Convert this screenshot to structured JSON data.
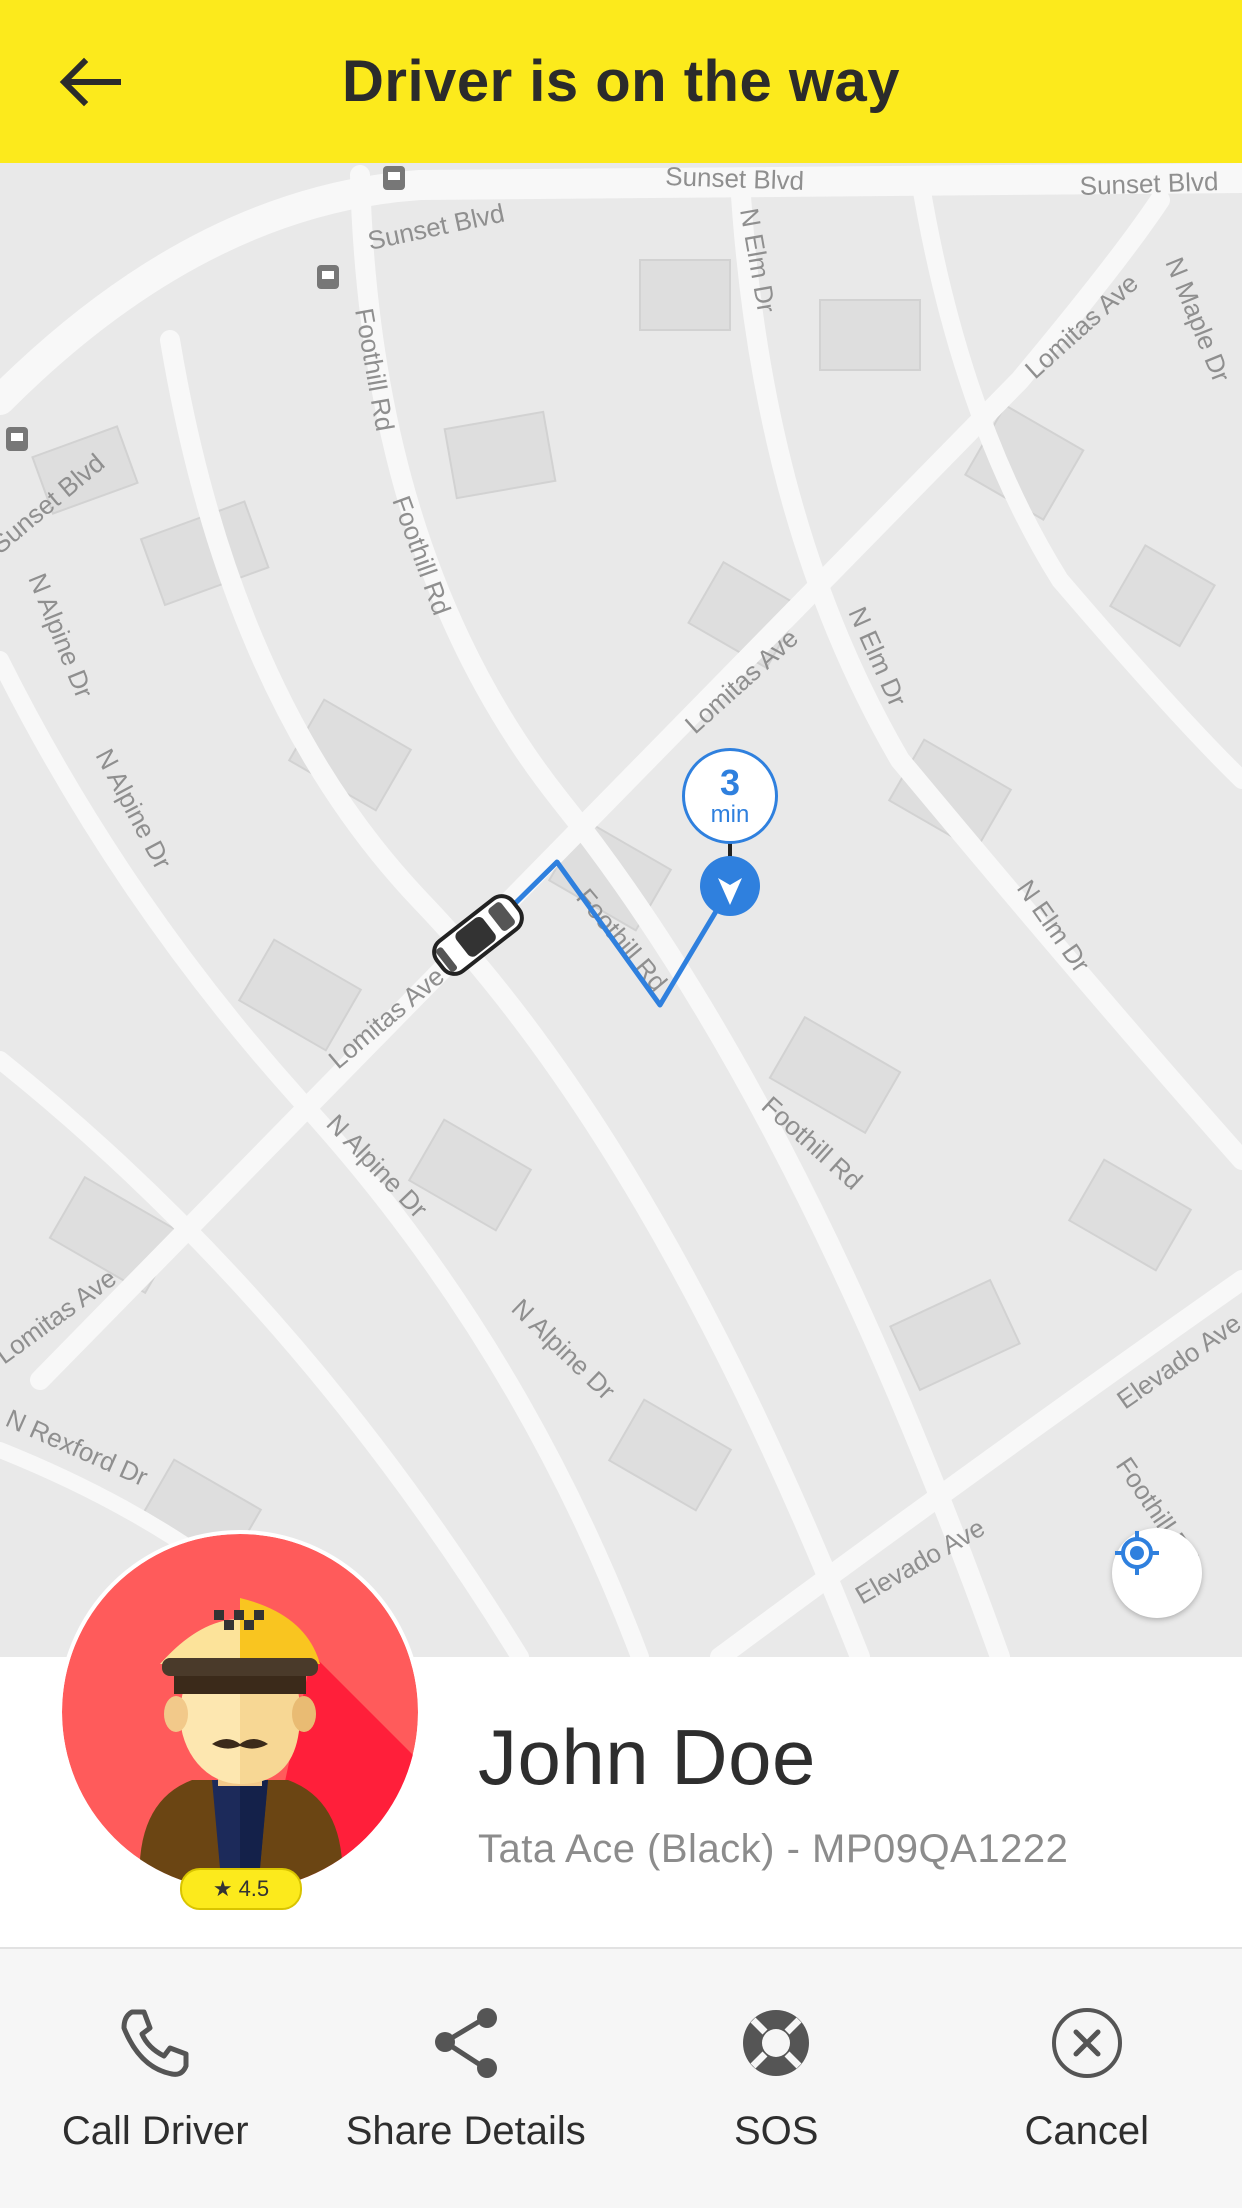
{
  "header": {
    "title": "Driver is on the way",
    "back_icon": "arrow-left-icon",
    "background": "#fcea1c"
  },
  "map": {
    "eta_value": "3",
    "eta_unit": "min",
    "route_color": "#2f80de",
    "street_labels": [
      "Sunset Blvd",
      "Sunset Blvd",
      "Sunset Blvd",
      "Sunset Blvd",
      "N Elm Dr",
      "N Elm Dr",
      "N Elm Dr",
      "Foothill Rd",
      "Foothill Rd",
      "Foothill Rd",
      "Foothill Rd",
      "Foothill Rd",
      "Lomitas Ave",
      "Lomitas Ave",
      "Lomitas Ave",
      "Lomitas Ave",
      "N Alpine Dr",
      "N Alpine Dr",
      "N Alpine Dr",
      "N Alpine Dr",
      "N Maple Dr",
      "Elevado Ave",
      "Elevado Ave",
      "N Rexford Dr"
    ],
    "locate_icon": "my-location-icon"
  },
  "driver": {
    "name": "John Doe",
    "vehicle": "Tata Ace (Black) - MP09QA1222",
    "rating": "4.5",
    "rating_icon": "star-icon"
  },
  "actions": [
    {
      "label": "Call Driver",
      "icon": "phone-icon"
    },
    {
      "label": "Share Details",
      "icon": "share-icon"
    },
    {
      "label": "SOS",
      "icon": "lifebuoy-icon"
    },
    {
      "label": "Cancel",
      "icon": "close-circle-icon"
    }
  ]
}
